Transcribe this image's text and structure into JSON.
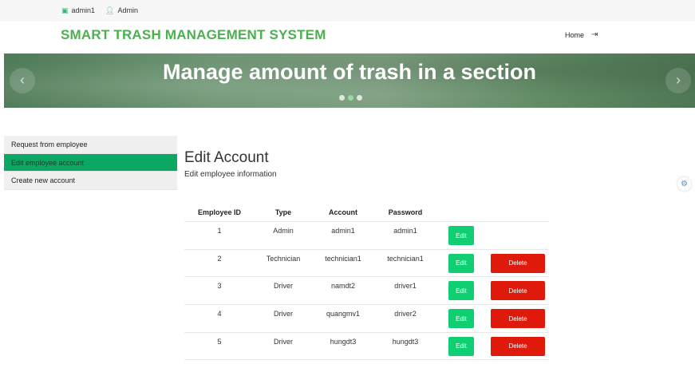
{
  "topbar": {
    "user": "admin1",
    "role": "Admin",
    "user_icon": "id-card-icon",
    "role_icon": "user-icon"
  },
  "header": {
    "brand": "SMART TRASH MANAGEMENT SYSTEM",
    "home_label": "Home",
    "logout_icon": "logout-icon"
  },
  "hero": {
    "title": "Manage amount of trash in a section",
    "prev": "‹",
    "next": "›",
    "slide_count": 3,
    "active_slide": 2
  },
  "sidebar": {
    "items": [
      {
        "label": "Request from employee",
        "active": false
      },
      {
        "label": "Edit employee account",
        "active": true
      },
      {
        "label": "Create new account",
        "active": false
      }
    ]
  },
  "main": {
    "title": "Edit Account",
    "subtitle": "Edit employee information",
    "table": {
      "columns": [
        "Employee ID",
        "Type",
        "Account",
        "Password"
      ],
      "rows": [
        {
          "id": "1",
          "type": "Admin",
          "account": "admin1",
          "password": "admin1",
          "can_delete": false
        },
        {
          "id": "2",
          "type": "Technician",
          "account": "technician1",
          "password": "technician1",
          "can_delete": true
        },
        {
          "id": "3",
          "type": "Driver",
          "account": "namdt2",
          "password": "driver1",
          "can_delete": true
        },
        {
          "id": "4",
          "type": "Driver",
          "account": "quangmv1",
          "password": "driver2",
          "can_delete": true
        },
        {
          "id": "5",
          "type": "Driver",
          "account": "hungdt3",
          "password": "hungdt3",
          "can_delete": true
        }
      ],
      "edit_label": "Edit",
      "delete_label": "Delete"
    }
  },
  "colors": {
    "brand": "#4caf50",
    "active_nav": "#0aa864",
    "edit": "#0fcf72",
    "delete": "#e01a0a"
  },
  "floating": {
    "icon": "gear-icon"
  }
}
